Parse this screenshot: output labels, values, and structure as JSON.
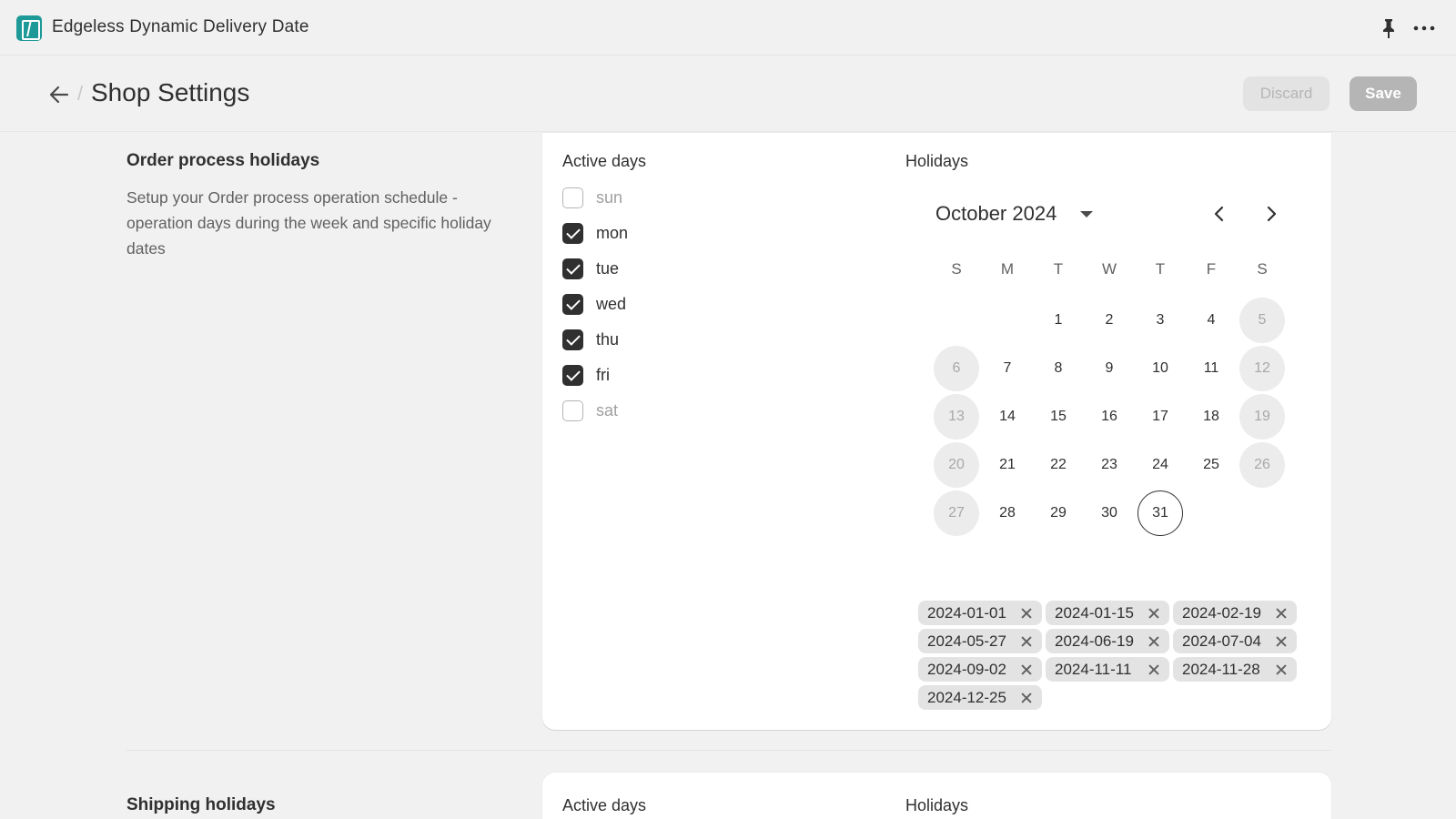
{
  "app": {
    "title": "Edgeless Dynamic Delivery Date"
  },
  "header": {
    "title": "Shop Settings",
    "separator": "/",
    "discard_label": "Discard",
    "save_label": "Save"
  },
  "sections": [
    {
      "title": "Order process holidays",
      "description": "Setup your Order process operation schedule - operation days during the week and specific holiday dates",
      "active_days_label": "Active days",
      "holidays_label": "Holidays",
      "days": [
        {
          "label": "sun",
          "checked": false
        },
        {
          "label": "mon",
          "checked": true
        },
        {
          "label": "tue",
          "checked": true
        },
        {
          "label": "wed",
          "checked": true
        },
        {
          "label": "thu",
          "checked": true
        },
        {
          "label": "fri",
          "checked": true
        },
        {
          "label": "sat",
          "checked": false
        }
      ],
      "calendar": {
        "month_label": "October 2024",
        "weekday_headers": [
          "S",
          "M",
          "T",
          "W",
          "T",
          "F",
          "S"
        ],
        "first_weekday_index": 2,
        "days_in_month": 31,
        "today": 31,
        "weekend_highlight": true
      },
      "holiday_tags": [
        "2024-01-01",
        "2024-01-15",
        "2024-02-19",
        "2024-05-27",
        "2024-06-19",
        "2024-07-04",
        "2024-09-02",
        "2024-11-11",
        "2024-11-28",
        "2024-12-25"
      ]
    },
    {
      "title": "Shipping holidays",
      "active_days_label": "Active days",
      "holidays_label": "Holidays"
    }
  ],
  "colors": {
    "accent_dark": "#303030",
    "app_logo": "#1d9a98",
    "weekend_bg": "#ececec"
  },
  "icons": {
    "back": "arrow-left-icon",
    "pin": "pin-icon",
    "more": "ellipsis-icon",
    "prev": "chevron-left-icon",
    "next": "chevron-right-icon",
    "caret": "caret-down-icon",
    "remove": "close-icon"
  }
}
